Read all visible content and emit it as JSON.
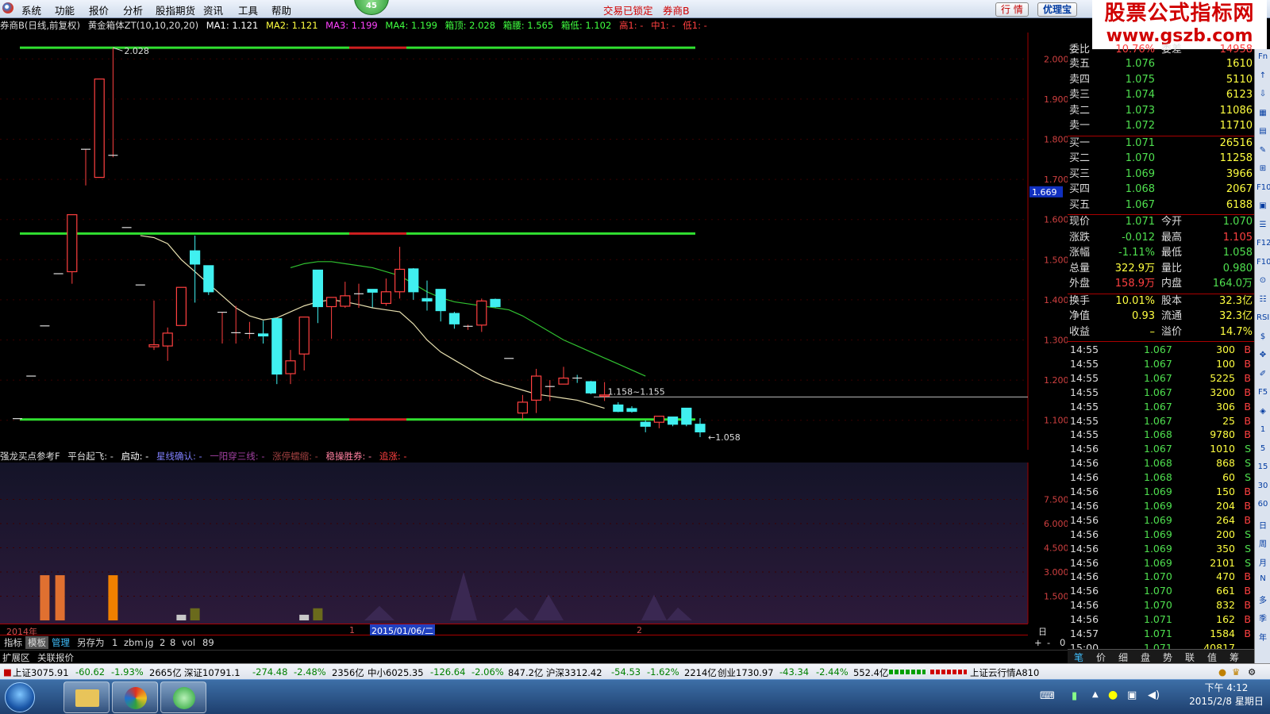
{
  "menubar": {
    "items": [
      "系统",
      "功能",
      "报价",
      "分析",
      "股指期货",
      "资讯",
      "工具",
      "帮助"
    ],
    "badge": "45",
    "lock_status": "交易已锁定",
    "broker": "券商B",
    "quote_btn": "行 情",
    "youlibao_btn": "优理宝"
  },
  "brand": {
    "line1": "股票公式指标网",
    "line2": "www.gszb.com"
  },
  "chart_header": {
    "title": "券商B(日线,前复权)",
    "indicator": "黄金箱体ZT(10,10,20,20)",
    "ma1": "MA1: 1.121",
    "ma2": "MA2: 1.121",
    "ma3": "MA3: 1.199",
    "ma4": "MA4: 1.199",
    "box_top": "箱顶: 2.028",
    "box_mid": "箱腰: 1.565",
    "box_low": "箱低: 1.102",
    "high1": "高1: -",
    "mid1": "中1: -",
    "low1": "低1: -"
  },
  "chart_data": {
    "type": "candlestick",
    "price_axis": {
      "min": 1.05,
      "max": 2.05,
      "ticks": [
        "2.000",
        "1.900",
        "1.800",
        "1.700",
        "1.600",
        "1.500",
        "1.400",
        "1.300",
        "1.200",
        "1.100"
      ]
    },
    "current_price_tag": "1.669",
    "annotations": {
      "high_label": "2.028",
      "low_label": "1.058",
      "range_label": "1.158~1.155"
    },
    "box_lines": {
      "top": 2.028,
      "mid": 1.565,
      "low": 1.102
    },
    "candles": [
      {
        "o": 1.104,
        "h": 1.104,
        "l": 1.104,
        "c": 1.104
      },
      {
        "o": 1.21,
        "h": 1.21,
        "l": 1.21,
        "c": 1.21
      },
      {
        "o": 1.335,
        "h": 1.335,
        "l": 1.335,
        "c": 1.335
      },
      {
        "o": 1.465,
        "h": 1.465,
        "l": 1.465,
        "c": 1.465
      },
      {
        "o": 1.47,
        "h": 1.612,
        "l": 1.44,
        "c": 1.612
      },
      {
        "o": 1.775,
        "h": 1.775,
        "l": 1.685,
        "c": 1.775
      },
      {
        "o": 1.705,
        "h": 1.95,
        "l": 1.705,
        "c": 1.95
      },
      {
        "o": 1.76,
        "h": 2.028,
        "l": 1.755,
        "c": 1.76
      },
      {
        "o": 1.58,
        "h": 1.58,
        "l": 1.58,
        "c": 1.58
      },
      {
        "o": 1.437,
        "h": 1.437,
        "l": 1.437,
        "c": 1.437
      },
      {
        "o": 1.283,
        "h": 1.398,
        "l": 1.275,
        "c": 1.288
      },
      {
        "o": 1.285,
        "h": 1.331,
        "l": 1.248,
        "c": 1.317
      },
      {
        "o": 1.336,
        "h": 1.431,
        "l": 1.336,
        "c": 1.431
      },
      {
        "o": 1.522,
        "h": 1.56,
        "l": 1.393,
        "c": 1.489
      },
      {
        "o": 1.485,
        "h": 1.485,
        "l": 1.412,
        "c": 1.42
      },
      {
        "o": 1.369,
        "h": 1.369,
        "l": 1.291,
        "c": 1.369
      },
      {
        "o": 1.318,
        "h": 1.385,
        "l": 1.291,
        "c": 1.318
      },
      {
        "o": 1.314,
        "h": 1.345,
        "l": 1.303,
        "c": 1.316
      },
      {
        "o": 1.315,
        "h": 1.348,
        "l": 1.291,
        "c": 1.31
      },
      {
        "o": 1.353,
        "h": 1.353,
        "l": 1.19,
        "c": 1.215
      },
      {
        "o": 1.216,
        "h": 1.275,
        "l": 1.19,
        "c": 1.248
      },
      {
        "o": 1.265,
        "h": 1.355,
        "l": 1.224,
        "c": 1.357
      },
      {
        "o": 1.474,
        "h": 1.474,
        "l": 1.342,
        "c": 1.383
      },
      {
        "o": 1.383,
        "h": 1.385,
        "l": 1.303,
        "c": 1.406
      },
      {
        "o": 1.384,
        "h": 1.445,
        "l": 1.38,
        "c": 1.41
      },
      {
        "o": 1.415,
        "h": 1.44,
        "l": 1.38,
        "c": 1.415
      },
      {
        "o": 1.426,
        "h": 1.426,
        "l": 1.381,
        "c": 1.419
      },
      {
        "o": 1.391,
        "h": 1.453,
        "l": 1.385,
        "c": 1.42
      },
      {
        "o": 1.42,
        "h": 1.532,
        "l": 1.403,
        "c": 1.476
      },
      {
        "o": 1.477,
        "h": 1.479,
        "l": 1.4,
        "c": 1.42
      },
      {
        "o": 1.403,
        "h": 1.448,
        "l": 1.373,
        "c": 1.397
      },
      {
        "o": 1.426,
        "h": 1.426,
        "l": 1.346,
        "c": 1.373
      },
      {
        "o": 1.366,
        "h": 1.37,
        "l": 1.328,
        "c": 1.34
      },
      {
        "o": 1.334,
        "h": 1.338,
        "l": 1.325,
        "c": 1.334
      },
      {
        "o": 1.337,
        "h": 1.403,
        "l": 1.32,
        "c": 1.397
      },
      {
        "o": 1.401,
        "h": 1.403,
        "l": 1.381,
        "c": 1.383
      },
      {
        "o": 1.254,
        "h": 1.254,
        "l": 1.254,
        "c": 1.254
      },
      {
        "o": 1.118,
        "h": 1.163,
        "l": 1.1,
        "c": 1.145
      },
      {
        "o": 1.15,
        "h": 1.228,
        "l": 1.118,
        "c": 1.21
      },
      {
        "o": 1.184,
        "h": 1.2,
        "l": 1.148,
        "c": 1.184
      },
      {
        "o": 1.19,
        "h": 1.233,
        "l": 1.19,
        "c": 1.205
      },
      {
        "o": 1.205,
        "h": 1.213,
        "l": 1.193,
        "c": 1.203
      },
      {
        "o": 1.196,
        "h": 1.198,
        "l": 1.165,
        "c": 1.168
      },
      {
        "o": 1.16,
        "h": 1.195,
        "l": 1.148,
        "c": 1.163
      },
      {
        "o": 1.138,
        "h": 1.145,
        "l": 1.12,
        "c": 1.122
      },
      {
        "o": 1.129,
        "h": 1.135,
        "l": 1.119,
        "c": 1.122
      },
      {
        "o": 1.095,
        "h": 1.1,
        "l": 1.07,
        "c": 1.085
      },
      {
        "o": 1.095,
        "h": 1.111,
        "l": 1.08,
        "c": 1.11
      },
      {
        "o": 1.108,
        "h": 1.108,
        "l": 1.085,
        "c": 1.09
      },
      {
        "o": 1.13,
        "h": 1.13,
        "l": 1.085,
        "c": 1.09
      },
      {
        "o": 1.09,
        "h": 1.105,
        "l": 1.058,
        "c": 1.071
      }
    ],
    "ma_short": [
      1.56,
      1.555,
      1.54,
      1.5,
      1.47,
      1.44,
      1.41,
      1.38,
      1.36,
      1.35,
      1.355,
      1.37,
      1.385,
      1.395,
      1.4,
      1.395,
      1.388,
      1.38,
      1.375,
      1.37,
      1.34,
      1.3,
      1.27,
      1.25,
      1.23,
      1.21,
      1.195,
      1.185,
      1.175,
      1.165,
      1.16,
      1.155,
      1.15,
      1.14,
      1.13
    ],
    "ma_long": [
      1.48,
      1.49,
      1.495,
      1.495,
      1.49,
      1.485,
      1.48,
      1.47,
      1.46,
      1.44,
      1.42,
      1.405,
      1.395,
      1.39,
      1.385,
      1.38,
      1.375,
      1.36,
      1.34,
      1.32,
      1.3,
      1.285,
      1.27,
      1.255,
      1.24,
      1.225,
      1.21
    ],
    "volume_bars": [
      {
        "i": 2,
        "v": 2.8,
        "c": "#e07030"
      },
      {
        "i": 3,
        "v": 2.8,
        "c": "#e07030"
      },
      {
        "i": 7,
        "v": 2.8,
        "c": "#f08000"
      },
      {
        "i": 12,
        "v": 0.35,
        "c": "#c8c8c8"
      },
      {
        "i": 13,
        "v": 0.75,
        "c": "#6a6a1c"
      },
      {
        "i": 21,
        "v": 0.35,
        "c": "#c8c8c8"
      },
      {
        "i": 22,
        "v": 0.75,
        "c": "#6a6a1c"
      }
    ],
    "volume_axis_ticks": [
      "7.500",
      "6.000",
      "4.500",
      "3.000",
      "1.500"
    ]
  },
  "sub_header": {
    "name": "强龙买点参考F",
    "f1": "平台起飞: -",
    "f2": "启动: -",
    "f3": "星线确认: -",
    "f4": "一阳穿三线: -",
    "f5": "涨停蠕缩: -",
    "f6": "稳操胜券: -",
    "f7": "追涨: -"
  },
  "date_axis": {
    "year": "2014年",
    "m1": "1",
    "date_sel": "2015/01/06/二",
    "m2": "2",
    "period": "日线"
  },
  "bottom_tabs": [
    "指标",
    "模板",
    "管理",
    "另存为",
    "1",
    "zbm",
    "jg",
    "2",
    "8",
    "vol",
    "89"
  ],
  "bottom_ctrl": [
    "+",
    "-",
    "0"
  ],
  "extra_row": [
    "扩展区",
    "关联报价"
  ],
  "quote": {
    "header": {
      "label": "委比",
      "value": "10.76%",
      "label2": "委差",
      "value2": "14958"
    },
    "sell": [
      {
        "label": "卖五",
        "price": "1.076",
        "vol": "1610"
      },
      {
        "label": "卖四",
        "price": "1.075",
        "vol": "5110"
      },
      {
        "label": "卖三",
        "price": "1.074",
        "vol": "6123"
      },
      {
        "label": "卖二",
        "price": "1.073",
        "vol": "11086"
      },
      {
        "label": "卖一",
        "price": "1.072",
        "vol": "11710"
      }
    ],
    "buy": [
      {
        "label": "买一",
        "price": "1.071",
        "vol": "26516"
      },
      {
        "label": "买二",
        "price": "1.070",
        "vol": "11258"
      },
      {
        "label": "买三",
        "price": "1.069",
        "vol": "3966"
      },
      {
        "label": "买四",
        "price": "1.068",
        "vol": "2067"
      },
      {
        "label": "买五",
        "price": "1.067",
        "vol": "6188"
      }
    ],
    "stats": [
      {
        "l1": "现价",
        "v1": "1.071",
        "c1": "#4fe04f",
        "l2": "今开",
        "v2": "1.070",
        "c2": "#4fe04f"
      },
      {
        "l1": "涨跌",
        "v1": "-0.012",
        "c1": "#4fe04f",
        "l2": "最高",
        "v2": "1.105",
        "c2": "#ff4040"
      },
      {
        "l1": "涨幅",
        "v1": "-1.11%",
        "c1": "#4fe04f",
        "l2": "最低",
        "v2": "1.058",
        "c2": "#4fe04f"
      },
      {
        "l1": "总量",
        "v1": "322.9万",
        "c1": "#ffff40",
        "l2": "量比",
        "v2": "0.980",
        "c2": "#4fe04f"
      },
      {
        "l1": "外盘",
        "v1": "158.9万",
        "c1": "#ff4040",
        "l2": "内盘",
        "v2": "164.0万",
        "c2": "#4fe04f"
      },
      {
        "l1": "换手",
        "v1": "10.01%",
        "c1": "#ffff40",
        "l2": "股本",
        "v2": "32.3亿",
        "c2": "#ffff40"
      },
      {
        "l1": "净值",
        "v1": "0.93",
        "c1": "#ffff40",
        "l2": "流通",
        "v2": "32.3亿",
        "c2": "#ffff40"
      },
      {
        "l1": "收益",
        "v1": "–",
        "c1": "#ffff40",
        "l2": "溢价",
        "v2": "14.7%",
        "c2": "#ffff40"
      }
    ]
  },
  "ticks": [
    {
      "t": "14:55",
      "p": "1.067",
      "v": "300",
      "s": "B"
    },
    {
      "t": "14:55",
      "p": "1.067",
      "v": "100",
      "s": "B"
    },
    {
      "t": "14:55",
      "p": "1.067",
      "v": "5225",
      "s": "B"
    },
    {
      "t": "14:55",
      "p": "1.067",
      "v": "3200",
      "s": "B"
    },
    {
      "t": "14:55",
      "p": "1.067",
      "v": "306",
      "s": "B"
    },
    {
      "t": "14:55",
      "p": "1.067",
      "v": "25",
      "s": "B"
    },
    {
      "t": "14:55",
      "p": "1.068",
      "v": "9780",
      "s": "B"
    },
    {
      "t": "14:56",
      "p": "1.067",
      "v": "1010",
      "s": "S"
    },
    {
      "t": "14:56",
      "p": "1.068",
      "v": "868",
      "s": "S"
    },
    {
      "t": "14:56",
      "p": "1.068",
      "v": "60",
      "s": "S"
    },
    {
      "t": "14:56",
      "p": "1.069",
      "v": "150",
      "s": "B"
    },
    {
      "t": "14:56",
      "p": "1.069",
      "v": "204",
      "s": "B"
    },
    {
      "t": "14:56",
      "p": "1.069",
      "v": "264",
      "s": "B"
    },
    {
      "t": "14:56",
      "p": "1.069",
      "v": "200",
      "s": "S"
    },
    {
      "t": "14:56",
      "p": "1.069",
      "v": "350",
      "s": "S"
    },
    {
      "t": "14:56",
      "p": "1.069",
      "v": "2101",
      "s": "S"
    },
    {
      "t": "14:56",
      "p": "1.070",
      "v": "470",
      "s": "B"
    },
    {
      "t": "14:56",
      "p": "1.070",
      "v": "661",
      "s": "B"
    },
    {
      "t": "14:56",
      "p": "1.070",
      "v": "832",
      "s": "B"
    },
    {
      "t": "14:56",
      "p": "1.071",
      "v": "162",
      "s": "B"
    },
    {
      "t": "14:57",
      "p": "1.071",
      "v": "1584",
      "s": "B"
    },
    {
      "t": "15:00",
      "p": "1.071",
      "v": "40817",
      "s": ""
    }
  ],
  "right_tabs": [
    "笔",
    "价",
    "细",
    "盘",
    "势",
    "联",
    "值",
    "筹"
  ],
  "sidebar_items": [
    "Fn",
    "↑",
    "⇩",
    "▦",
    "▤",
    "✎",
    "⊞",
    "F10",
    "▣",
    "☰",
    "F12",
    "F10",
    "⊙",
    "☷",
    "RSI",
    "$",
    "✥",
    "✐",
    "F5",
    "◈",
    "1",
    "5",
    "15",
    "30",
    "60",
    "日",
    "周",
    "月",
    "N",
    "多",
    "季",
    "年"
  ],
  "status": {
    "sh": "上证3075.91",
    "sh_chg": "-60.62",
    "sh_pct": "-1.93%",
    "sh_amt": "2665亿",
    "sz": "深证10791.1",
    "sz_chg": "-274.48",
    "sz_pct": "-2.48%",
    "sz_amt": "2356亿",
    "zx": "中小6025.35",
    "zx_chg": "-126.64",
    "zx_pct": "-2.06%",
    "zx_amt": "847.2亿",
    "hs": "沪深3312.42",
    "hs_chg": "-54.53",
    "hs_pct": "-1.62%",
    "hs_amt": "2214亿",
    "cy": "创业1730.97",
    "cy_chg": "-43.34",
    "cy_pct": "-2.44%",
    "cy_amt": "552.4亿",
    "cloud": "上证云行情A810"
  },
  "clock": {
    "time": "下午 4:12",
    "date": "2015/2/8 星期日"
  }
}
